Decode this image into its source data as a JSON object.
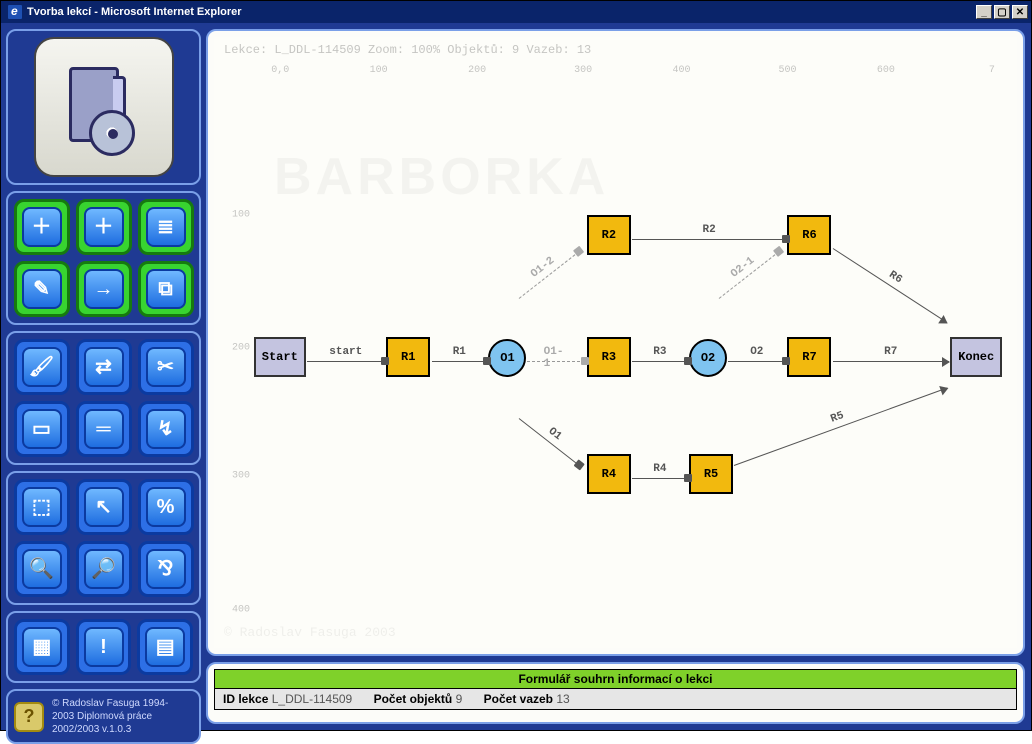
{
  "window": {
    "title": "Tvorba lekcí - Microsoft Internet Explorer"
  },
  "canvas": {
    "status_line": "Lekce: L_DDL-114509  Zoom: 100% Objektů: 9 Vazeb: 13",
    "watermark": "BARBORKA",
    "watermark_footer": "© Radoslav Fasuga 2003",
    "ruler_x": {
      "0": "0,0",
      "100": "100",
      "200": "200",
      "300": "300",
      "400": "400",
      "500": "500",
      "600": "600",
      "700": "7"
    },
    "ruler_y": {
      "100": "100",
      "200": "200",
      "300": "300",
      "400": "400"
    },
    "nodes": {
      "start": "Start",
      "r1": "R1",
      "o1": "O1",
      "r2": "R2",
      "r3": "R3",
      "r4": "R4",
      "o2": "O2",
      "r5": "R5",
      "r6": "R6",
      "r7": "R7",
      "end": "Konec"
    },
    "edges": {
      "start_r1": "start",
      "r1_o1": "R1",
      "o1_r2": "O1-2",
      "o1_r3": "O1-1",
      "o1_r4": "O1",
      "r2_r6": "R2",
      "r3_o2": "R3",
      "o2_r6": "O2-1",
      "o2_r7": "O2",
      "r4_r5": "R4",
      "r5_end": "R5",
      "r6_end": "R6",
      "r7_end": "R7"
    }
  },
  "form": {
    "title": "Formulář souhrn informací o lekci",
    "id_label": "ID lekce",
    "id_value": "L_DDL-114509",
    "obj_label": "Počet objektů",
    "obj_value": "9",
    "link_label": "Počet vazeb",
    "link_value": "13"
  },
  "sidebar": {
    "copyright_l1": "© Radoslav Fasuga 1994-",
    "copyright_l2": "2003 Diplomová práce",
    "copyright_l3": "2002/2003 v.1.0.3",
    "tools": {
      "g1": [
        "add-lesson",
        "add-item",
        "list-items",
        "edit-lesson",
        "link-items",
        "clone-item"
      ],
      "g2": [
        "paint",
        "swap",
        "cut",
        "layer",
        "align",
        "select-path"
      ],
      "g3": [
        "pointer-area",
        "pointer",
        "percent-list",
        "zoom-in",
        "zoom-out",
        "zoom-percent"
      ],
      "g4": [
        "overview",
        "highlight-error",
        "report"
      ]
    },
    "glyphs": {
      "add-lesson": "＋",
      "add-item": "＋",
      "list-items": "≣",
      "edit-lesson": "✎",
      "link-items": "→",
      "clone-item": "⧉",
      "paint": "🖌",
      "swap": "⇄",
      "cut": "✂",
      "layer": "▭",
      "align": "═",
      "select-path": "↯",
      "pointer-area": "⬚",
      "pointer": "↖",
      "percent-list": "%",
      "zoom-in": "🔍",
      "zoom-out": "🔎",
      "zoom-percent": "⅋",
      "overview": "▦",
      "highlight-error": "!",
      "report": "▤"
    }
  }
}
